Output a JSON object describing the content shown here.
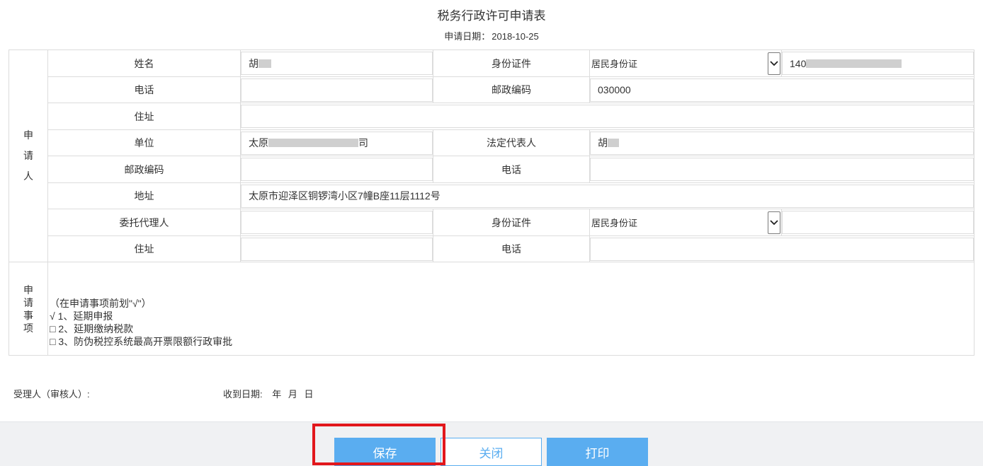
{
  "title": "税务行政许可申请表",
  "apply_date": {
    "label": "申请日期：",
    "value": "2018-10-25"
  },
  "section_applicant": "申请人",
  "section_items": "申请事项",
  "applicant": {
    "name": {
      "label": "姓名",
      "value": "胡"
    },
    "id_doc": {
      "label": "身份证件",
      "type": "居民身份证",
      "number": "140"
    },
    "phone": {
      "label": "电话",
      "value": ""
    },
    "postcode": {
      "label": "邮政编码",
      "value": "030000"
    },
    "address": {
      "label": "住址",
      "value": ""
    }
  },
  "company": {
    "unit": {
      "label": "单位",
      "value_prefix": "太原",
      "value_suffix": "司"
    },
    "legal_rep": {
      "label": "法定代表人",
      "value": "胡"
    },
    "postcode": {
      "label": "邮政编码",
      "value": ""
    },
    "phone": {
      "label": "电话",
      "value": ""
    },
    "address": {
      "label": "地址",
      "value": "太原市迎泽区铜锣湾小区7幢B座11层1112号"
    }
  },
  "agent": {
    "name": {
      "label": "委托代理人",
      "value": ""
    },
    "id_doc": {
      "label": "身份证件",
      "type": "居民身份证",
      "number": ""
    },
    "address": {
      "label": "住址",
      "value": ""
    },
    "phone": {
      "label": "电话",
      "value": ""
    }
  },
  "items": {
    "instruction": "（在申请事项前划\"√\"）",
    "list": [
      {
        "mark": "√",
        "text": "1、延期申报"
      },
      {
        "mark": "□",
        "text": "2、延期缴纳税款"
      },
      {
        "mark": "□",
        "text": "3、防伪税控系统最高开票限额行政审批"
      }
    ]
  },
  "footer": {
    "receiver_label": "受理人（审核人）:",
    "received_date_label": "收到日期:",
    "year": "年",
    "month": "月",
    "day": "日"
  },
  "buttons": {
    "save": "保存",
    "close": "关闭",
    "print": "打印"
  },
  "colors": {
    "accent": "#5aadf0",
    "highlight": "#e2171c",
    "bar_bg": "#f0f1f3"
  }
}
